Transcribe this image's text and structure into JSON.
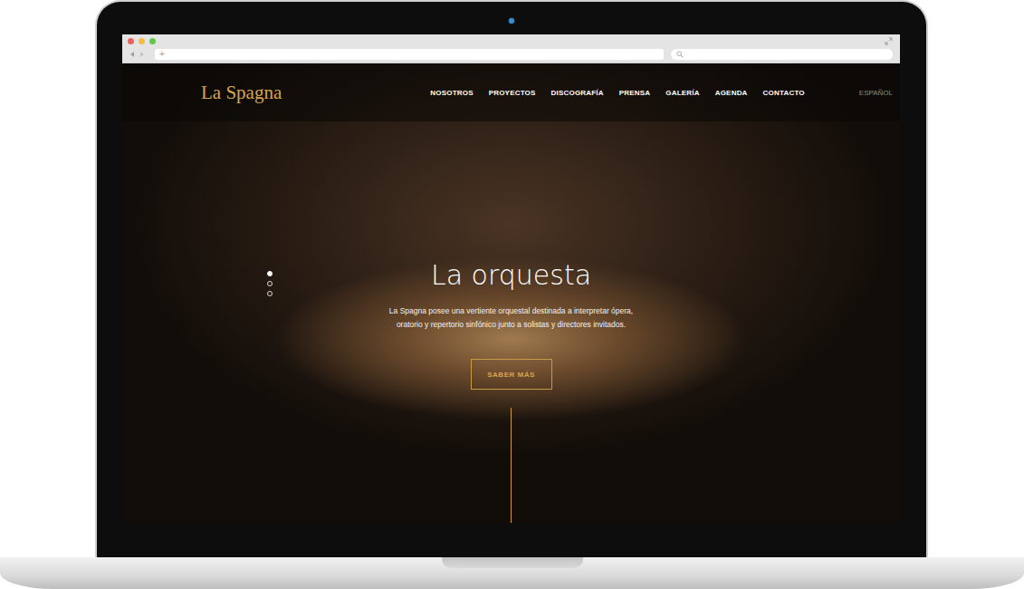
{
  "browser": {
    "address": "",
    "new_tab": "+",
    "search": ""
  },
  "site": {
    "logo": "La Spagna",
    "nav": [
      {
        "label": "NOSOTROS"
      },
      {
        "label": "PROYECTOS"
      },
      {
        "label": "DISCOGRAFÍA"
      },
      {
        "label": "PRENSA"
      },
      {
        "label": "GALERÍA"
      },
      {
        "label": "AGENDA"
      },
      {
        "label": "CONTACTO"
      }
    ],
    "language": "ESPAÑOL",
    "slides": [
      {
        "selected": true
      },
      {
        "selected": false
      },
      {
        "selected": false
      }
    ],
    "hero": {
      "title": "La orquesta",
      "text": "La Spagna posee una vertiente orquestal destinada a interpretar ópera, oratorio y repertorio sinfónico junto a solistas y directores invitados.",
      "button": "SABER MÁS"
    }
  }
}
